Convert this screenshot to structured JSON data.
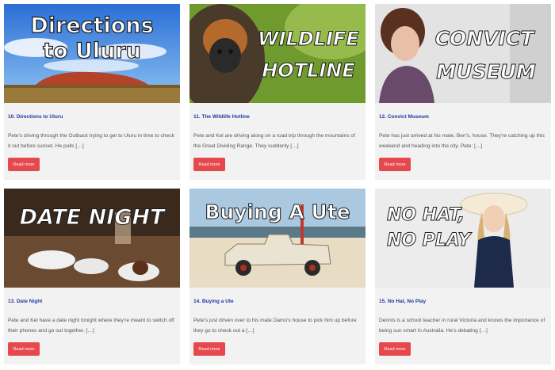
{
  "cards": [
    {
      "image_text": [
        "Directions",
        "to Uluru"
      ],
      "title": "10. Directions to Uluru",
      "excerpt": "Pete's driving through the Outback trying to get to Uluru in time to check it out before sunset. He pulls […]",
      "button": "Read more"
    },
    {
      "image_text": [
        "WILDLIFE",
        "HOTLINE"
      ],
      "title": "11. The Wildlife Hotline",
      "excerpt": "Pete and Kel are driving along on a road trip through the mountains of the Great Dividing Range. They suddenly […]",
      "button": "Read more"
    },
    {
      "image_text": [
        "CONVICT",
        "MUSEUM"
      ],
      "title": "12. Convict Museum",
      "excerpt": "Pete has just arrived at his mate, Ben's, house. They're catching up this weekend and heading into the city. Pete: […]",
      "button": "Read more"
    },
    {
      "image_text": [
        "DATE NIGHT"
      ],
      "title": "13. Date Night",
      "excerpt": "Pete and Kel have a date night tonight where they're meant to switch off their phones and go out together. […]",
      "button": "Read more"
    },
    {
      "image_text": [
        "Buying A Ute"
      ],
      "title": "14. Buying a Ute",
      "excerpt": "Pete's just driven over to his mate Damo's house to pick him up before they go to check out a […]",
      "button": "Read more"
    },
    {
      "image_text": [
        "NO HAT,",
        "NO PLAY"
      ],
      "title": "15. No Hat, No Play",
      "excerpt": "Dennis is a school teacher in rural Victoria and knows the importance of being sun smart in Australia. He's debating […]",
      "button": "Read more"
    }
  ],
  "colors": {
    "title": "#1f3aa3",
    "button": "#e5484d",
    "card_bg": "#f2f2f2"
  }
}
